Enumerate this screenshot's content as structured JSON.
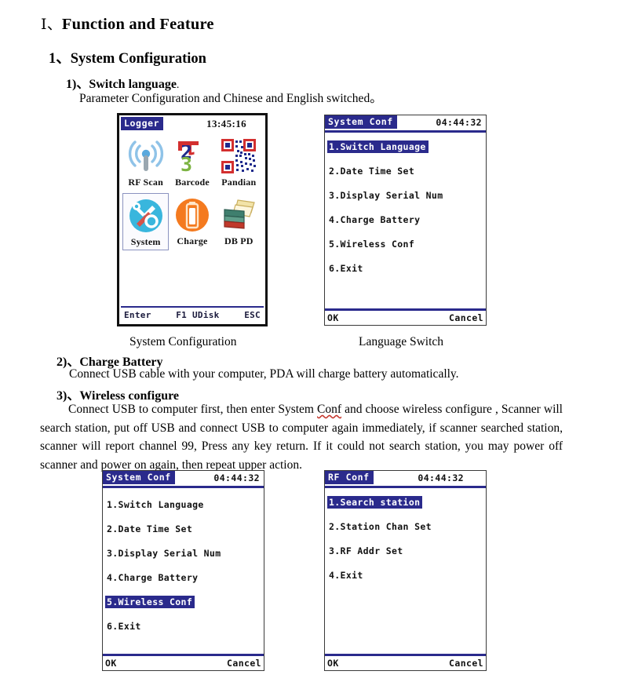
{
  "document": {
    "heading1": {
      "numeral": "Ⅰ、",
      "text": "Function and Feature"
    },
    "heading2": {
      "numeral": "1、",
      "text": "System Configuration"
    },
    "section1": {
      "numeral": "1)、",
      "title": "Switch language",
      "title_tail": ".",
      "body": "Parameter Configuration and Chinese and English switched。"
    },
    "section2": {
      "numeral": "2)、",
      "title": "Charge Battery",
      "body": "Connect USB cable with your computer, PDA will charge battery automatically."
    },
    "section3": {
      "numeral": "3)、",
      "title": "Wireless configure",
      "body_before": "Connect USB to computer first, then enter System ",
      "body_squiggle": "Conf",
      "body_after": " and choose wireless configure , Scanner will search station, put off USB and connect USB to computer again immediately, if scanner searched station, scanner will report channel 99, Press any key return. If it could not search station, you may power off scanner and power on again, then repeat upper action."
    },
    "captions": {
      "left": "System Configuration",
      "right": "Language Switch"
    }
  },
  "screens": {
    "logger_home": {
      "title": "Logger",
      "clock": "13:45:16",
      "tiles": [
        {
          "label": "RF Scan",
          "icon": "rf-signal-icon",
          "selected": false
        },
        {
          "label": "Barcode",
          "icon": "barcode-123-icon",
          "selected": false
        },
        {
          "label": "Pandian",
          "icon": "qr-code-icon",
          "selected": false
        },
        {
          "label": "System",
          "icon": "tools-gear-icon",
          "selected": true
        },
        {
          "label": "Charge",
          "icon": "battery-icon",
          "selected": false
        },
        {
          "label": "DB PD",
          "icon": "books-icon",
          "selected": false
        }
      ],
      "softkeys": {
        "left": "Enter",
        "center": "F1 UDisk",
        "right": "ESC"
      }
    },
    "system_conf_a": {
      "title": "System Conf",
      "clock": "04:44:32",
      "items": [
        {
          "label": "1.Switch Language",
          "selected": true
        },
        {
          "label": "2.Date Time Set",
          "selected": false
        },
        {
          "label": "3.Display Serial Num",
          "selected": false
        },
        {
          "label": "4.Charge Battery",
          "selected": false
        },
        {
          "label": "5.Wireless Conf",
          "selected": false
        },
        {
          "label": "6.Exit",
          "selected": false
        }
      ],
      "softkeys": {
        "left": "OK",
        "right": "Cancel"
      }
    },
    "system_conf_b": {
      "title": "System Conf",
      "clock": "04:44:32",
      "items": [
        {
          "label": "1.Switch Language",
          "selected": false
        },
        {
          "label": "2.Date Time Set",
          "selected": false
        },
        {
          "label": "3.Display Serial Num",
          "selected": false
        },
        {
          "label": "4.Charge Battery",
          "selected": false
        },
        {
          "label": "5.Wireless Conf",
          "selected": true
        },
        {
          "label": "6.Exit",
          "selected": false
        }
      ],
      "softkeys": {
        "left": "OK",
        "right": "Cancel"
      }
    },
    "rf_conf": {
      "title": "RF Conf",
      "clock": "04:44:32",
      "items": [
        {
          "label": "1.Search station",
          "selected": true
        },
        {
          "label": "2.Station Chan Set",
          "selected": false
        },
        {
          "label": "3.RF Addr Set",
          "selected": false
        },
        {
          "label": "4.Exit",
          "selected": false
        }
      ],
      "softkeys": {
        "left": "OK",
        "right": "Cancel"
      }
    }
  },
  "colors": {
    "title_blue": "#2a2a8c",
    "highlight_blue": "#2a2a8c",
    "lcd_background": "#ffffff",
    "squiggle_red": "#c4342a"
  }
}
